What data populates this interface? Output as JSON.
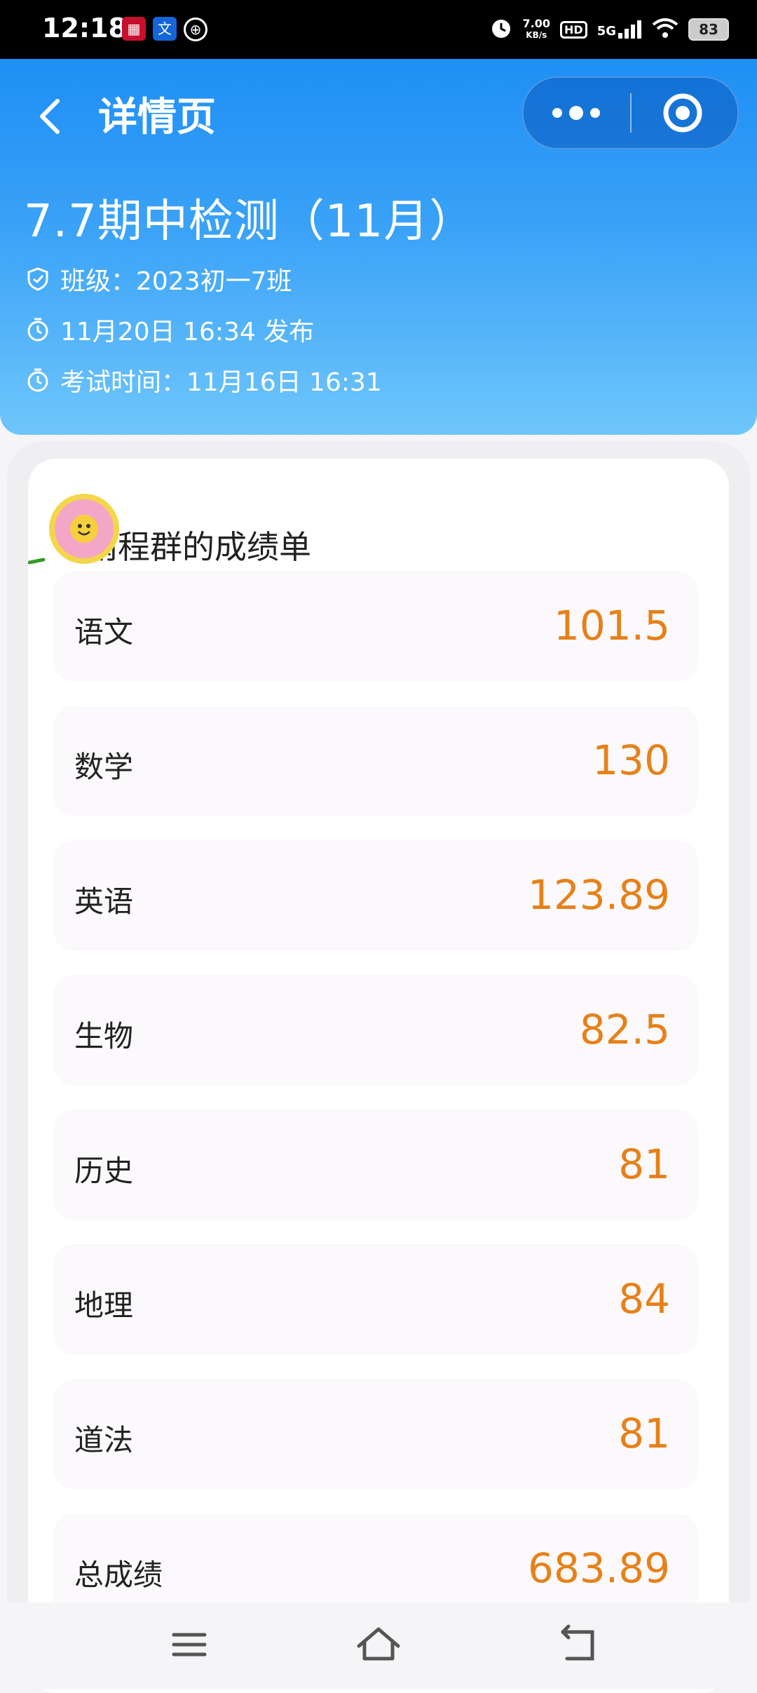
{
  "status_bar": {
    "time": "12:18",
    "net_speed_value": "7.00",
    "net_speed_unit": "KB/s",
    "hd": "HD",
    "network": "5G",
    "battery": "83",
    "apps": [
      "app-icon-red",
      "app-icon-blue",
      "app-icon-circle"
    ]
  },
  "header": {
    "nav_title": "详情页",
    "exam_title": "7.7期中检测（11月）",
    "class_label": "班级：2023初一7班",
    "publish_time": "11月20日 16:34 发布",
    "exam_time": "考试时间：11月16日 16:31"
  },
  "report": {
    "title": "雨程群的成绩单",
    "rows": [
      {
        "subject": "语文",
        "score": "101.5"
      },
      {
        "subject": "数学",
        "score": "130"
      },
      {
        "subject": "英语",
        "score": "123.89"
      },
      {
        "subject": "生物",
        "score": "82.5"
      },
      {
        "subject": "历史",
        "score": "81"
      },
      {
        "subject": "地理",
        "score": "84"
      },
      {
        "subject": "道法",
        "score": "81"
      },
      {
        "subject": "总成绩",
        "score": "683.89"
      }
    ]
  },
  "colors": {
    "header_top": "#1e8ff5",
    "header_bottom": "#6fc6fb",
    "score": "#e68119"
  },
  "nav_icons": [
    "menu-icon",
    "home-icon",
    "back-icon"
  ]
}
